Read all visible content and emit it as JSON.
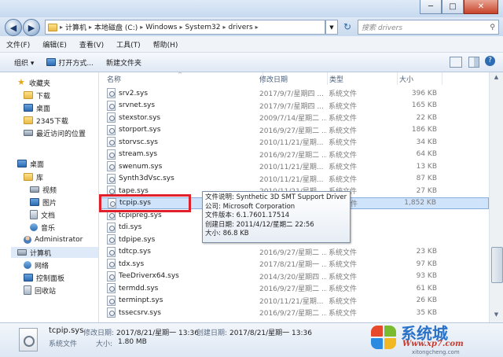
{
  "window": {
    "minimize": "─",
    "maximize": "□",
    "close": "✕"
  },
  "address": {
    "crumbs": [
      "计算机",
      "本地磁盘 (C:)",
      "Windows",
      "System32",
      "drivers"
    ],
    "refresh": "↻",
    "search_placeholder": "搜索 drivers"
  },
  "menu": [
    "文件(F)",
    "编辑(E)",
    "查看(V)",
    "工具(T)",
    "帮助(H)"
  ],
  "toolbar": {
    "organize": "组织 ▾",
    "open_with": "打开方式...",
    "new_folder": "新建文件夹"
  },
  "nav": {
    "favorites": "收藏夹",
    "fav_items": [
      "下载",
      "桌面",
      "2345下载",
      "最近访问的位置"
    ],
    "desktop": "桌面",
    "library": "库",
    "lib_items": [
      "视频",
      "图片",
      "文档",
      "音乐"
    ],
    "user": "Administrator",
    "computer": "计算机",
    "network": "网络",
    "control_panel": "控制面板",
    "recycle_bin": "回收站"
  },
  "columns": {
    "name": "名称",
    "date": "修改日期",
    "type": "类型",
    "size": "大小"
  },
  "files": [
    {
      "name": "srv2.sys",
      "date": "2017/9/7/星期四 ...",
      "type": "系统文件",
      "size": "396 KB"
    },
    {
      "name": "srvnet.sys",
      "date": "2017/9/7/星期四 ...",
      "type": "系统文件",
      "size": "165 KB"
    },
    {
      "name": "stexstor.sys",
      "date": "2009/7/14/星期二 ...",
      "type": "系统文件",
      "size": "22 KB"
    },
    {
      "name": "storport.sys",
      "date": "2016/9/27/星期二 ...",
      "type": "系统文件",
      "size": "186 KB"
    },
    {
      "name": "storvsc.sys",
      "date": "2010/11/21/星期...",
      "type": "系统文件",
      "size": "34 KB"
    },
    {
      "name": "stream.sys",
      "date": "2016/9/27/星期二 ...",
      "type": "系统文件",
      "size": "64 KB"
    },
    {
      "name": "swenum.sys",
      "date": "2010/11/21/星期...",
      "type": "系统文件",
      "size": "13 KB"
    },
    {
      "name": "Synth3dVsc.sys",
      "date": "2010/11/21/星期...",
      "type": "系统文件",
      "size": "87 KB"
    },
    {
      "name": "tape.sys",
      "date": "2010/11/21/星期...",
      "type": "系统文件",
      "size": "27 KB"
    },
    {
      "name": "tcpip.sys",
      "date": "2017/8/21/星期一 ...",
      "type": "系统文件",
      "size": "1,852 KB"
    },
    {
      "name": "tcpipreg.sys",
      "date": "",
      "type": "",
      "size": ""
    },
    {
      "name": "tdi.sys",
      "date": "",
      "type": "",
      "size": ""
    },
    {
      "name": "tdpipe.sys",
      "date": "",
      "type": "",
      "size": ""
    },
    {
      "name": "tdtcp.sys",
      "date": "2016/9/27/星期二 ...",
      "type": "系统文件",
      "size": "23 KB"
    },
    {
      "name": "tdx.sys",
      "date": "2017/8/21/星期一 ...",
      "type": "系统文件",
      "size": "97 KB"
    },
    {
      "name": "TeeDriverx64.sys",
      "date": "2014/3/20/星期四 ...",
      "type": "系统文件",
      "size": "93 KB"
    },
    {
      "name": "termdd.sys",
      "date": "2016/9/27/星期二 ...",
      "type": "系统文件",
      "size": "61 KB"
    },
    {
      "name": "terminpt.sys",
      "date": "2010/11/21/星期...",
      "type": "系统文件",
      "size": "26 KB"
    },
    {
      "name": "tssecsrv.sys",
      "date": "2016/9/27/星期二 ...",
      "type": "系统文件",
      "size": "35 KB"
    }
  ],
  "tooltip": {
    "line1": "文件说明: Synthetic 3D SMT Support Driver",
    "line2": "公司: Microsoft Corporation",
    "line3": "文件版本: 6.1.7601.17514",
    "line4": "创建日期: 2011/4/12/星期二 22:56",
    "line5": "大小: 86.8 KB"
  },
  "details": {
    "filename": "tcpip.sys",
    "modified_label": "修改日期:",
    "modified": "2017/8/21/星期一 13:36",
    "created_label": "创建日期:",
    "created": "2017/8/21/星期一 13:36",
    "type": "系统文件",
    "size_label": "大小:",
    "size": "1.80 MB"
  },
  "watermark": {
    "text": "系统城",
    "url": "Www.xp7.com",
    "url2": "xitongcheng.com"
  },
  "colors": {
    "highlight_border": "#e0212b",
    "selection": "#cfe3fb"
  }
}
